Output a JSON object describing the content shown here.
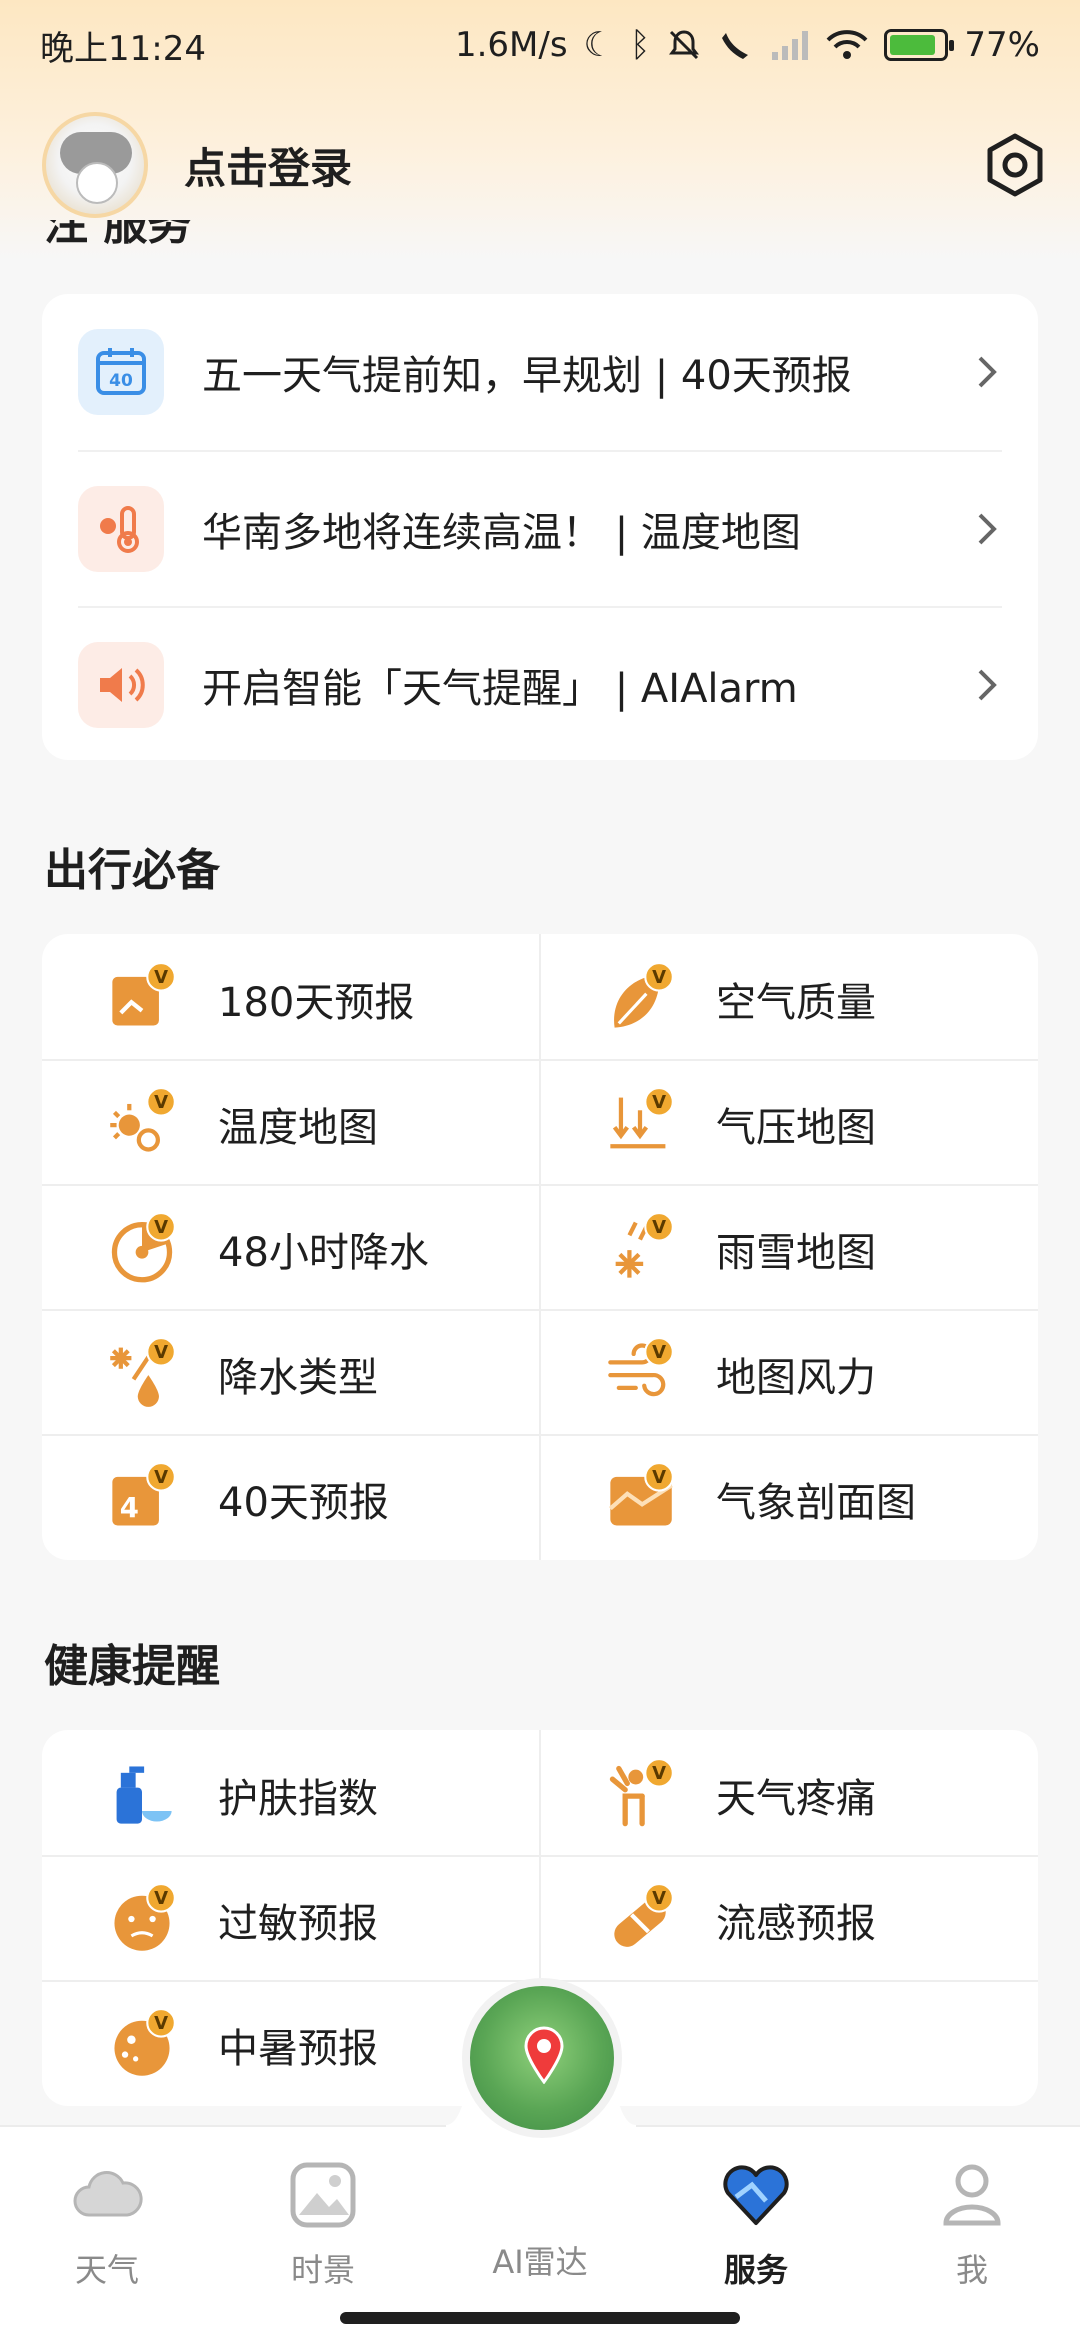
{
  "status_bar": {
    "time": "晚上11:24",
    "speed": "1.6M/s",
    "battery": "77%",
    "battery_level": 0.77
  },
  "header": {
    "login_text": "点击登录"
  },
  "partial_section_title": "注 服务",
  "feature_list": [
    {
      "label": "五一天气提前知，早规划 | 40天预报",
      "icon": "calendar-40-icon"
    },
    {
      "label": "华南多地将连续高温！ | 温度地图",
      "icon": "thermometer-icon"
    },
    {
      "label": "开启智能「天气提醒」 | AIAlarm",
      "icon": "speaker-icon"
    }
  ],
  "travel": {
    "title": "出行必备",
    "items": [
      {
        "label": "180天预报",
        "icon": "calendar-180-icon"
      },
      {
        "label": "空气质量",
        "icon": "leaf-icon"
      },
      {
        "label": "温度地图",
        "icon": "sun-thermometer-icon"
      },
      {
        "label": "气压地图",
        "icon": "pressure-icon"
      },
      {
        "label": "48小时降水",
        "icon": "rain-48h-icon"
      },
      {
        "label": "雨雪地图",
        "icon": "rain-snow-icon"
      },
      {
        "label": "降水类型",
        "icon": "precip-type-icon"
      },
      {
        "label": "地图风力",
        "icon": "wind-icon"
      },
      {
        "label": "40天预报",
        "icon": "calendar-40-icon"
      },
      {
        "label": "气象剖面图",
        "icon": "profile-chart-icon"
      }
    ]
  },
  "health": {
    "title": "健康提醒",
    "items": [
      {
        "label": "护肤指数",
        "icon": "skincare-icon"
      },
      {
        "label": "天气疼痛",
        "icon": "pain-icon"
      },
      {
        "label": "过敏预报",
        "icon": "allergy-icon"
      },
      {
        "label": "流感预报",
        "icon": "flu-pill-icon"
      },
      {
        "label": "中暑预报",
        "icon": "heatstroke-icon"
      }
    ]
  },
  "vip_badge": "V",
  "nav": {
    "items": [
      {
        "label": "天气",
        "icon": "cloud-icon"
      },
      {
        "label": "时景",
        "icon": "picture-icon"
      },
      {
        "label": "AI雷达",
        "icon": "radar-map-icon"
      },
      {
        "label": "服务",
        "icon": "heart-service-icon"
      },
      {
        "label": "我",
        "icon": "person-icon"
      }
    ],
    "active": "服务"
  },
  "colors": {
    "accent_orange": "#e8963a",
    "text": "#1f1f1f",
    "muted": "#8a8a8a",
    "nav_active": "#2b73d8"
  }
}
